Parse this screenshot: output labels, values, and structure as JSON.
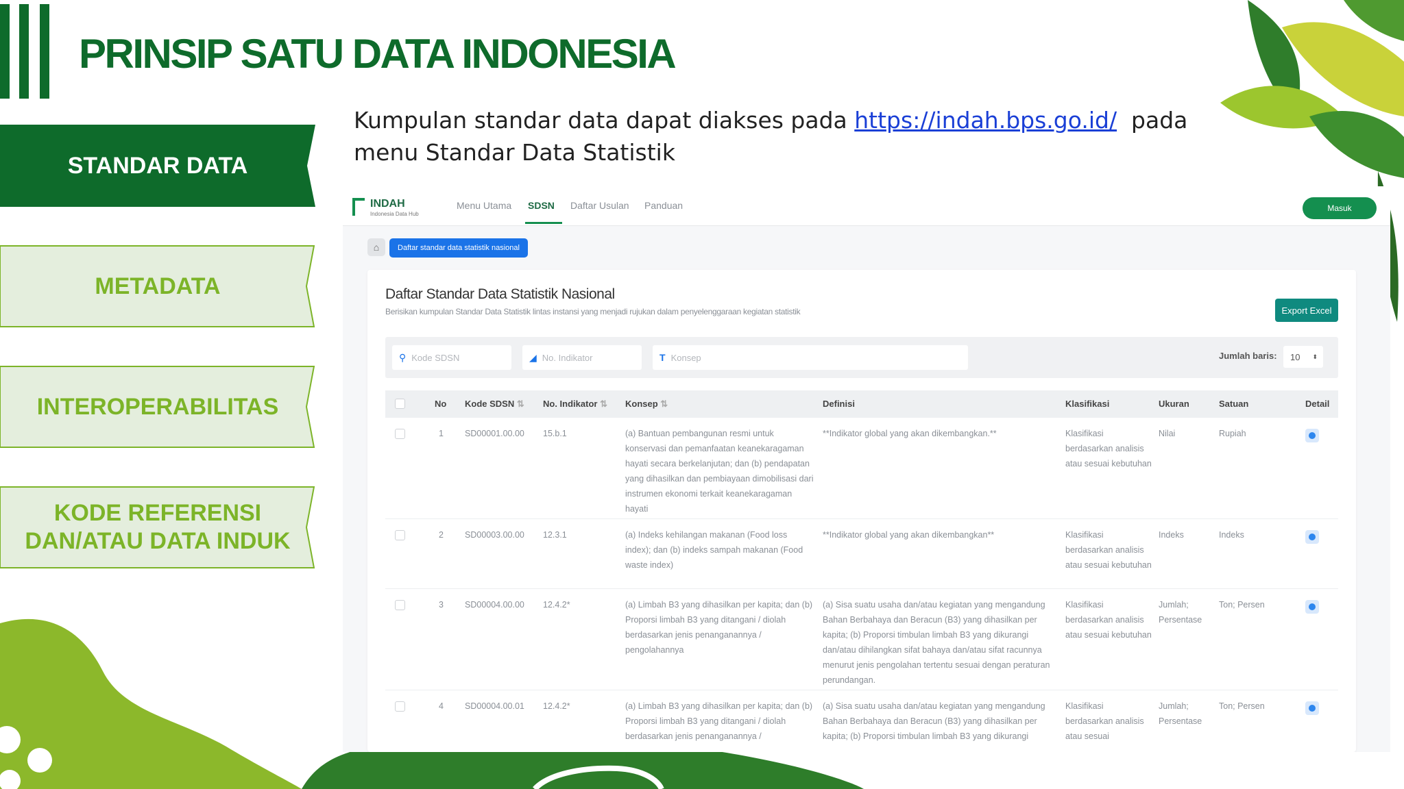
{
  "slide": {
    "title": "PRINSIP SATU DATA INDONESIA",
    "nav": [
      {
        "label": "STANDAR DATA",
        "active": true
      },
      {
        "label": "METADATA",
        "active": false
      },
      {
        "label": "INTEROPERABILITAS",
        "active": false
      },
      {
        "label": "KODE REFERENSI\nDAN/ATAU DATA INDUK",
        "active": false
      }
    ],
    "description": {
      "before": "Kumpulan standar data dapat diakses pada ",
      "link": "https://indah.bps.go.id/",
      "after": "  pada menu Standar Data Statistik"
    },
    "colors": {
      "dark_green": "#0e6b2b",
      "light_green": "#7cb428",
      "pale_green": "#e4eedd",
      "link_blue": "#1a3fd6"
    }
  },
  "app": {
    "brand": "INDAH",
    "brand_sub": "Indonesia Data Hub",
    "menu": [
      "Menu Utama",
      "SDSN",
      "Daftar Usulan",
      "Panduan"
    ],
    "active_menu": "SDSN",
    "login_label": "Masuk",
    "breadcrumb_icon": "home-icon",
    "breadcrumb": "Daftar standar data statistik nasional",
    "card_title": "Daftar Standar Data Statistik Nasional",
    "card_subtitle": "Berisikan kumpulan Standar Data Statistik lintas instansi yang menjadi rujukan dalam penyelenggaraan kegiatan statistik",
    "export_label": "Export Excel",
    "filters": {
      "kode_placeholder": "Kode SDSN",
      "indikator_placeholder": "No. Indikator",
      "konsep_placeholder": "Konsep",
      "rows_label": "Jumlah baris:",
      "rows_value": "10"
    },
    "columns": [
      "No",
      "Kode SDSN",
      "No. Indikator",
      "Konsep",
      "Definisi",
      "Klasifikasi",
      "Ukuran",
      "Satuan",
      "Detail"
    ],
    "rows": [
      {
        "no": "1",
        "kode": "SD00001.00.00",
        "indikator": "15.b.1",
        "konsep": "(a) Bantuan pembangunan resmi untuk konservasi dan pemanfaatan keanekaragaman hayati secara berkelanjutan; dan (b) pendapatan yang dihasilkan dan pembiayaan dimobilisasi dari instrumen ekonomi terkait keanekaragaman hayati",
        "definisi": "**Indikator global yang akan dikembangkan.**",
        "klasifikasi": "Klasifikasi berdasarkan analisis atau sesuai kebutuhan",
        "ukuran": "Nilai",
        "satuan": "Rupiah"
      },
      {
        "no": "2",
        "kode": "SD00003.00.00",
        "indikator": "12.3.1",
        "konsep": "(a) Indeks kehilangan makanan (Food loss index); dan (b) indeks sampah makanan (Food waste index)",
        "definisi": "**Indikator global yang akan dikembangkan**",
        "klasifikasi": "Klasifikasi berdasarkan analisis atau sesuai kebutuhan",
        "ukuran": "Indeks",
        "satuan": "Indeks"
      },
      {
        "no": "3",
        "kode": "SD00004.00.00",
        "indikator": "12.4.2*",
        "konsep": "(a) Limbah B3 yang dihasilkan per kapita; dan (b) Proporsi limbah B3 yang ditangani / diolah berdasarkan jenis penanganannya / pengolahannya",
        "definisi": "(a) Sisa suatu usaha dan/atau kegiatan yang mengandung Bahan Berbahaya dan Beracun (B3) yang dihasilkan per kapita; (b) Proporsi timbulan limbah B3 yang dikurangi dan/atau dihilangkan sifat bahaya dan/atau sifat racunnya menurut jenis pengolahan tertentu sesuai dengan peraturan perundangan.",
        "klasifikasi": "Klasifikasi berdasarkan analisis atau sesuai kebutuhan",
        "ukuran": "Jumlah; Persentase",
        "satuan": "Ton; Persen"
      },
      {
        "no": "4",
        "kode": "SD00004.00.01",
        "indikator": "12.4.2*",
        "konsep": "(a) Limbah B3 yang dihasilkan per kapita; dan (b) Proporsi limbah B3 yang ditangani / diolah berdasarkan jenis penanganannya /",
        "definisi": "(a) Sisa suatu usaha dan/atau kegiatan yang mengandung Bahan Berbahaya dan Beracun (B3) yang dihasilkan per kapita; (b) Proporsi timbulan limbah B3 yang dikurangi",
        "klasifikasi": "Klasifikasi berdasarkan analisis atau sesuai",
        "ukuran": "Jumlah; Persentase",
        "satuan": "Ton; Persen"
      }
    ]
  }
}
